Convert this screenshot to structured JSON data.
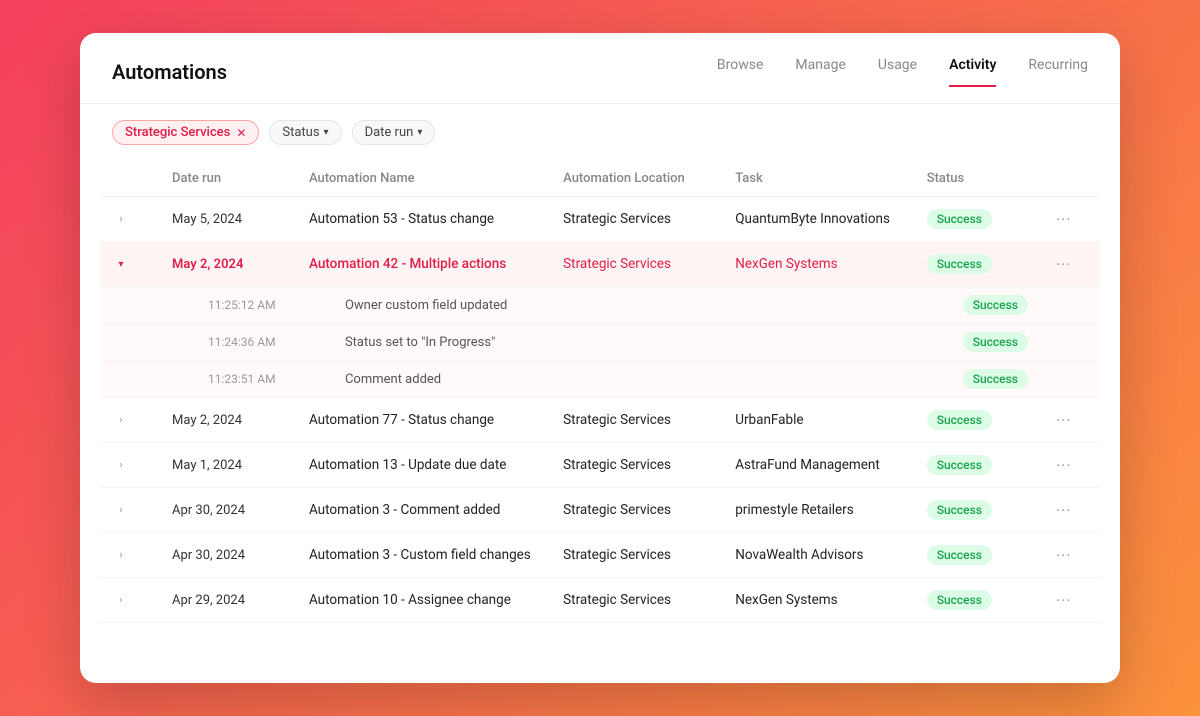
{
  "app": {
    "title": "Automations"
  },
  "tabs": [
    {
      "id": "browse",
      "label": "Browse",
      "active": false
    },
    {
      "id": "manage",
      "label": "Manage",
      "active": false
    },
    {
      "id": "usage",
      "label": "Usage",
      "active": false
    },
    {
      "id": "activity",
      "label": "Activity",
      "active": true
    },
    {
      "id": "recurring",
      "label": "Recurring",
      "active": false
    }
  ],
  "filters": {
    "tag": "Strategic Services",
    "status_label": "Status",
    "daterun_label": "Date run"
  },
  "table": {
    "columns": [
      "Date run",
      "Automation Name",
      "Automation Location",
      "Task",
      "Status"
    ],
    "rows": [
      {
        "id": "row1",
        "expand": false,
        "date": "May 5, 2024",
        "automation": "Automation 53 - Status change",
        "location": "Strategic Services",
        "task": "QuantumByte Innovations",
        "status": "Success",
        "highlighted": false,
        "subrows": []
      },
      {
        "id": "row2",
        "expand": true,
        "date": "May 2, 2024",
        "automation": "Automation 42 - Multiple actions",
        "location": "Strategic Services",
        "task": "NexGen Systems",
        "status": "Success",
        "highlighted": true,
        "subrows": [
          {
            "time": "11:25:12 AM",
            "action": "Owner custom field updated",
            "status": "Success"
          },
          {
            "time": "11:24:36 AM",
            "action": "Status set to \"In Progress\"",
            "status": "Success"
          },
          {
            "time": "11:23:51 AM",
            "action": "Comment added",
            "status": "Success"
          }
        ]
      },
      {
        "id": "row3",
        "expand": false,
        "date": "May 2, 2024",
        "automation": "Automation 77 - Status change",
        "location": "Strategic Services",
        "task": "UrbanFable",
        "status": "Success",
        "highlighted": false,
        "subrows": []
      },
      {
        "id": "row4",
        "expand": false,
        "date": "May 1, 2024",
        "automation": "Automation 13 - Update due date",
        "location": "Strategic Services",
        "task": "AstraFund Management",
        "status": "Success",
        "highlighted": false,
        "subrows": []
      },
      {
        "id": "row5",
        "expand": false,
        "date": "Apr 30, 2024",
        "automation": "Automation 3 - Comment added",
        "location": "Strategic Services",
        "task": "primestyle Retailers",
        "status": "Success",
        "highlighted": false,
        "subrows": []
      },
      {
        "id": "row6",
        "expand": false,
        "date": "Apr 30, 2024",
        "automation": "Automation 3 - Custom field changes",
        "location": "Strategic Services",
        "task": "NovaWealth Advisors",
        "status": "Success",
        "highlighted": false,
        "subrows": []
      },
      {
        "id": "row7",
        "expand": false,
        "date": "Apr 29, 2024",
        "automation": "Automation 10 - Assignee change",
        "location": "Strategic Services",
        "task": "NexGen Systems",
        "status": "Success",
        "highlighted": false,
        "subrows": []
      }
    ]
  }
}
